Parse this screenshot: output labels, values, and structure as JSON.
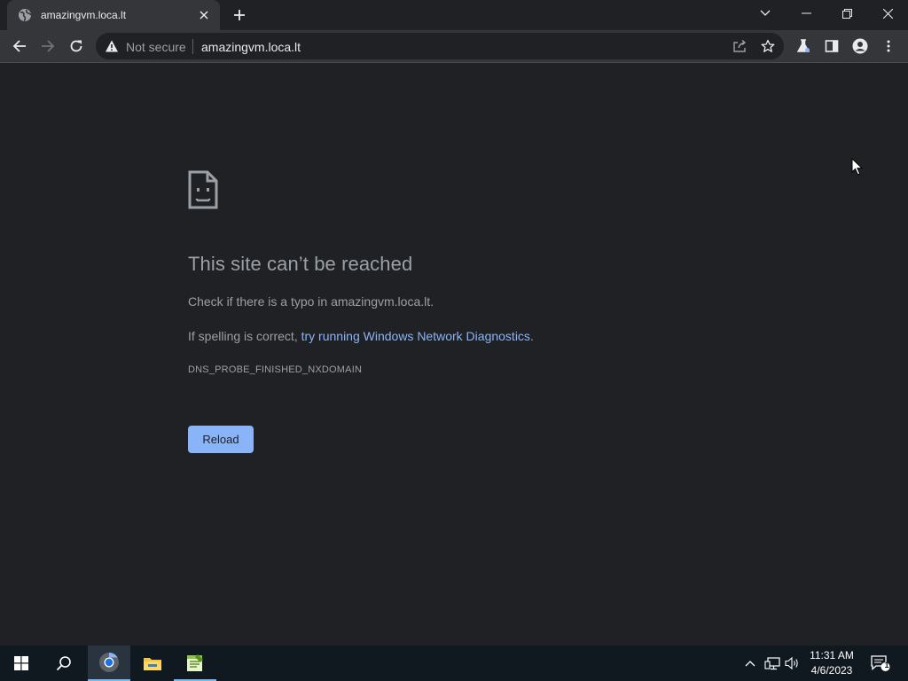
{
  "tab": {
    "title": "amazingvm.loca.lt",
    "favicon": "globe-icon"
  },
  "toolbar": {
    "security_label": "Not secure",
    "url": "amazingvm.loca.lt"
  },
  "error_page": {
    "title": "This site can’t be reached",
    "line1": "Check if there is a typo in amazingvm.loca.lt.",
    "line2_prefix": "If spelling is correct, ",
    "line2_link": "try running Windows Network Diagnostics",
    "line2_suffix": ".",
    "error_code": "DNS_PROBE_FINISHED_NXDOMAIN",
    "reload_label": "Reload"
  },
  "taskbar": {
    "apps": [
      "start",
      "search",
      "chrome",
      "file-explorer",
      "notepad-plus-plus"
    ],
    "time": "11:31 AM",
    "date": "4/6/2023",
    "notification_count": "1"
  },
  "colors": {
    "page_bg": "#202124",
    "toolbar_bg": "#35363a",
    "link": "#8ab4f8",
    "button_bg": "#8ab4f8",
    "taskbar_bg": "#101820"
  }
}
